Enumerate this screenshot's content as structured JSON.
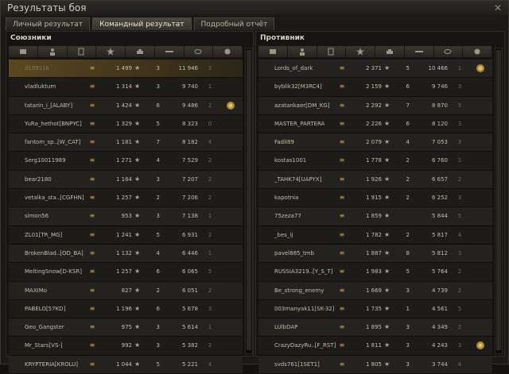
{
  "window": {
    "title": "Результаты боя",
    "close_glyph": "✕"
  },
  "tabs": [
    {
      "label": "Личный результат",
      "active": false
    },
    {
      "label": "Командный результат",
      "active": true
    },
    {
      "label": "Подробный отчёт",
      "active": false
    }
  ],
  "allies": {
    "title": "Союзники",
    "rows": [
      {
        "name": "d19911k",
        "rating": "1 499",
        "kills": "3",
        "damage": "11 946",
        "xp": "3",
        "medal": false,
        "me": true,
        "dead": true
      },
      {
        "name": "vladluktum",
        "rating": "1 314",
        "kills": "3",
        "damage": "9 740",
        "xp": "1",
        "medal": false
      },
      {
        "name": "tatarin_i_[ALABY]",
        "rating": "1 424",
        "kills": "6",
        "damage": "9 486",
        "xp": "2",
        "medal": true
      },
      {
        "name": "YuRa_hethot[BNPYC]",
        "rating": "1 329",
        "kills": "5",
        "damage": "8 323",
        "xp": "0",
        "medal": false
      },
      {
        "name": "fantom_sp..[W_CAT]",
        "rating": "1 181",
        "kills": "7",
        "damage": "8 182",
        "xp": "4",
        "medal": false
      },
      {
        "name": "Serg10011989",
        "rating": "1 271",
        "kills": "4",
        "damage": "7 529",
        "xp": "2",
        "medal": false
      },
      {
        "name": "bear2180",
        "rating": "1 164",
        "kills": "3",
        "damage": "7 207",
        "xp": "2",
        "medal": false
      },
      {
        "name": "vetalka_sta..[CGFHN]",
        "rating": "1 257",
        "kills": "2",
        "damage": "7 206",
        "xp": "2",
        "medal": false
      },
      {
        "name": "simon56",
        "rating": "953",
        "kills": "3",
        "damage": "7 138",
        "xp": "1",
        "medal": false
      },
      {
        "name": "ZL01[TR_MG]",
        "rating": "1 241",
        "kills": "5",
        "damage": "6 931",
        "xp": "2",
        "medal": false
      },
      {
        "name": "BrokenBlad..[OD_BA]",
        "rating": "1 132",
        "kills": "4",
        "damage": "6 446",
        "xp": "1",
        "medal": false
      },
      {
        "name": "MeltingSnow[D-KSR]",
        "rating": "1 257",
        "kills": "6",
        "damage": "6 065",
        "xp": "5",
        "medal": false
      },
      {
        "name": "MAXIMo",
        "rating": "827",
        "kills": "2",
        "damage": "6 051",
        "xp": "2",
        "medal": false
      },
      {
        "name": "PABELO[57KD]",
        "rating": "1 196",
        "kills": "6",
        "damage": "5 678",
        "xp": "3",
        "medal": false
      },
      {
        "name": "Geo_Gangster",
        "rating": "975",
        "kills": "3",
        "damage": "5 614",
        "xp": "1",
        "medal": false
      },
      {
        "name": "Mr_Stars[VS-]",
        "rating": "992",
        "kills": "3",
        "damage": "5 382",
        "xp": "2",
        "medal": false
      },
      {
        "name": "KRYPTERIA[KROLU]",
        "rating": "1 044",
        "kills": "5",
        "damage": "5 221",
        "xp": "4",
        "medal": false
      }
    ]
  },
  "enemies": {
    "title": "Противник",
    "rows": [
      {
        "name": "Lords_of_dark",
        "rating": "2 371",
        "kills": "5",
        "damage": "10 466",
        "xp": "1",
        "medal": true
      },
      {
        "name": "byblik32[M3RC4]",
        "rating": "2 159",
        "kills": "6",
        "damage": "9 746",
        "xp": "3",
        "medal": false
      },
      {
        "name": "azatankaer[DM_KG]",
        "rating": "2 292",
        "kills": "7",
        "damage": "8 870",
        "xp": "5",
        "medal": false
      },
      {
        "name": "MASTER_PARTERA",
        "rating": "2 226",
        "kills": "6",
        "damage": "8 120",
        "xp": "3",
        "medal": false
      },
      {
        "name": "Fadil89",
        "rating": "2 079",
        "kills": "4",
        "damage": "7 053",
        "xp": "3",
        "medal": false
      },
      {
        "name": "kostas1001",
        "rating": "1 778",
        "kills": "2",
        "damage": "6 760",
        "xp": "1",
        "medal": false
      },
      {
        "name": "_TAHK74[UAPYX]",
        "rating": "1 926",
        "kills": "2",
        "damage": "6 657",
        "xp": "2",
        "medal": false
      },
      {
        "name": "kapotnia",
        "rating": "1 915",
        "kills": "2",
        "damage": "6 252",
        "xp": "3",
        "medal": false
      },
      {
        "name": "75zeza77",
        "rating": "1 859",
        "kills": "",
        "damage": "5 844",
        "xp": "5",
        "medal": false
      },
      {
        "name": "_bes_ij",
        "rating": "1 782",
        "kills": "2",
        "damage": "5 817",
        "xp": "4",
        "medal": false
      },
      {
        "name": "pavel885_tmb",
        "rating": "1 887",
        "kills": "8",
        "damage": "5 812",
        "xp": "3",
        "medal": false
      },
      {
        "name": "RUSSIA3219..[Y_S_T]",
        "rating": "1 983",
        "kills": "5",
        "damage": "5 764",
        "xp": "2",
        "medal": false
      },
      {
        "name": "Be_strong_enemy",
        "rating": "1 669",
        "kills": "3",
        "damage": "4 739",
        "xp": "2",
        "medal": false
      },
      {
        "name": "003manyak11[SK-32]",
        "rating": "1 735",
        "kills": "1",
        "damage": "4 561",
        "xp": "5",
        "medal": false
      },
      {
        "name": "LUlbDAP",
        "rating": "1 895",
        "kills": "3",
        "damage": "4 349",
        "xp": "2",
        "medal": false
      },
      {
        "name": "CrazyDazyRu..[F_RST]",
        "rating": "1 811",
        "kills": "3",
        "damage": "4 243",
        "xp": "3",
        "medal": true
      },
      {
        "name": "svds761[1SET1]",
        "rating": "1 805",
        "kills": "3",
        "damage": "3 744",
        "xp": "4",
        "medal": false
      }
    ]
  },
  "glyphs": {
    "star": "★",
    "rank": "≡"
  },
  "colors": {
    "accent": "#c9a23a",
    "row_me": "#5b4720",
    "bg": "#1b1916"
  }
}
